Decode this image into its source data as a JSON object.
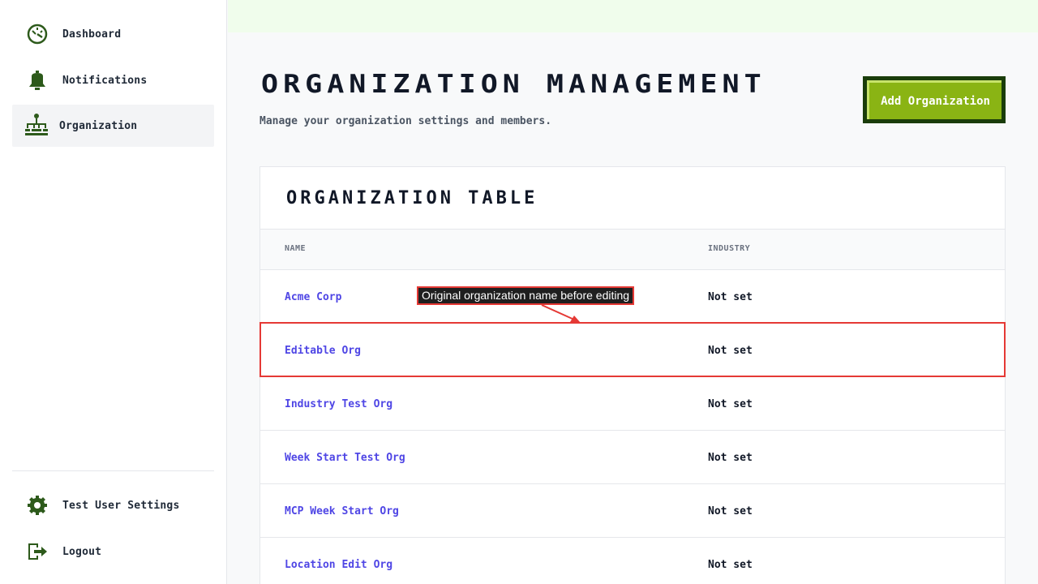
{
  "sidebar": {
    "items": [
      {
        "label": "Dashboard",
        "icon": "dashboard-icon"
      },
      {
        "label": "Notifications",
        "icon": "bell-icon"
      },
      {
        "label": "Organization",
        "icon": "org-chart-icon",
        "active": true
      }
    ],
    "bottom_items": [
      {
        "label": "Test User Settings",
        "icon": "gear-icon"
      },
      {
        "label": "Logout",
        "icon": "logout-icon"
      }
    ]
  },
  "header": {
    "title": "Organization Management",
    "subtitle": "Manage your organization settings and members.",
    "add_button_label": "Add Organization"
  },
  "table": {
    "title": "Organization Table",
    "columns": [
      "Name",
      "Industry"
    ],
    "rows": [
      {
        "name": "Acme Corp",
        "industry": "Not set"
      },
      {
        "name": "Editable Org",
        "industry": "Not set"
      },
      {
        "name": "Industry Test Org",
        "industry": "Not set"
      },
      {
        "name": "Week Start Test Org",
        "industry": "Not set"
      },
      {
        "name": "MCP Week Start Org",
        "industry": "Not set"
      },
      {
        "name": "Location Edit Org",
        "industry": "Not set"
      }
    ]
  },
  "annotation": {
    "text": "Original organization name before editing"
  },
  "colors": {
    "accent_green": "#8ab414",
    "dark_green": "#1a3d0a",
    "link": "#4f46e5",
    "annotation_red": "#e53935"
  }
}
